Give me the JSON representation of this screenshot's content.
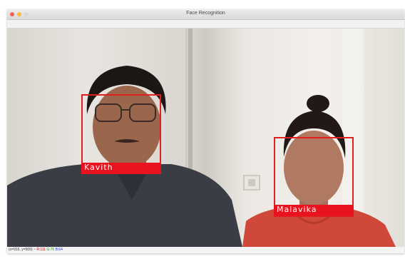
{
  "window": {
    "title": "Face Recognition"
  },
  "detections": [
    {
      "name": "Kavith",
      "color": "#e8131e"
    },
    {
      "name": "Malavika",
      "color": "#e8131e"
    }
  ],
  "statusbar": {
    "coords": "(x=916, y=509) ~",
    "r": "R:111",
    "g": "G:76",
    "b": "B:64"
  }
}
